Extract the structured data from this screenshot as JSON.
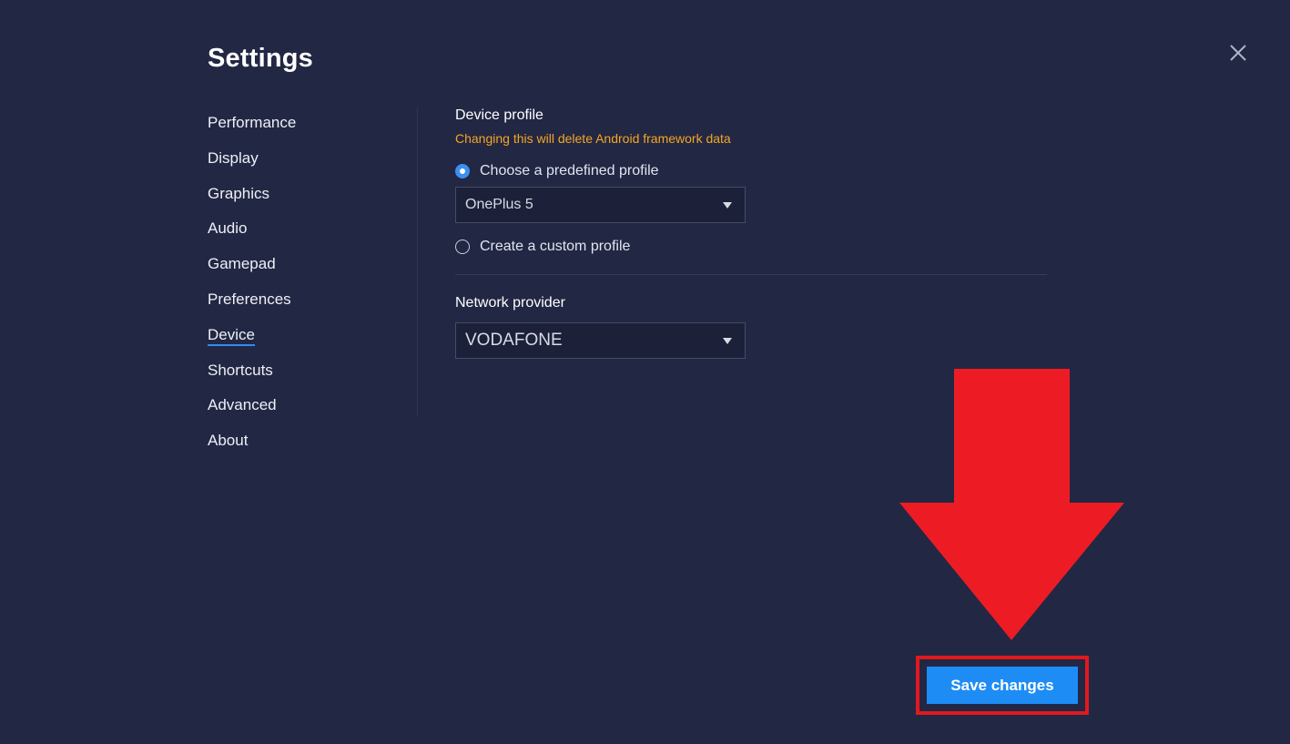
{
  "header": {
    "title": "Settings"
  },
  "sidebar": {
    "items": [
      {
        "label": "Performance",
        "active": false
      },
      {
        "label": "Display",
        "active": false
      },
      {
        "label": "Graphics",
        "active": false
      },
      {
        "label": "Audio",
        "active": false
      },
      {
        "label": "Gamepad",
        "active": false
      },
      {
        "label": "Preferences",
        "active": false
      },
      {
        "label": "Device",
        "active": true
      },
      {
        "label": "Shortcuts",
        "active": false
      },
      {
        "label": "Advanced",
        "active": false
      },
      {
        "label": "About",
        "active": false
      }
    ]
  },
  "device": {
    "profile_title": "Device profile",
    "profile_warning": "Changing this will delete Android framework data",
    "predefined_label": "Choose a predefined profile",
    "predefined_selected": true,
    "predefined_value": "OnePlus 5",
    "custom_label": "Create a custom profile",
    "custom_selected": false,
    "network_title": "Network provider",
    "network_value": "VODAFONE"
  },
  "footer": {
    "save_label": "Save changes"
  },
  "colors": {
    "background": "#222744",
    "accent": "#1e8cf5",
    "warning": "#f5a623",
    "annotation": "#e1191e"
  },
  "icons": {
    "close": "close-icon",
    "dropdown": "chevron-down-icon",
    "annotation_arrow": "arrow-down-icon"
  }
}
